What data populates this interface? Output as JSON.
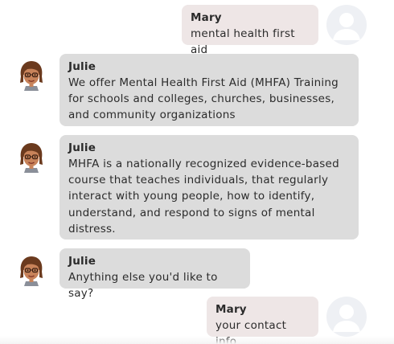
{
  "colors": {
    "user_bubble": "#eee6e6",
    "bot_bubble": "#dcdcdc",
    "text": "#2b2b2b",
    "user_avatar_bg": "#eef0f4"
  },
  "messages": [
    {
      "sender": "Mary",
      "role": "user",
      "avatar": "user-silhouette-icon",
      "text": "mental health first aid"
    },
    {
      "sender": "Julie",
      "role": "bot",
      "avatar": "julie-bitmoji-avatar",
      "text": "We offer Mental Health First Aid (MHFA) Training for schools and colleges, churches, businesses, and community organizations"
    },
    {
      "sender": "Julie",
      "role": "bot",
      "avatar": "julie-bitmoji-avatar",
      "text": "MHFA is a nationally recognized evidence-based course that teaches individuals, that regularly interact with young people, how to identify, understand, and respond to signs of mental distress."
    },
    {
      "sender": "Julie",
      "role": "bot",
      "avatar": "julie-bitmoji-avatar",
      "text": "Anything else you'd like to say?"
    },
    {
      "sender": "Mary",
      "role": "user",
      "avatar": "user-silhouette-icon",
      "text": "your contact info"
    }
  ]
}
